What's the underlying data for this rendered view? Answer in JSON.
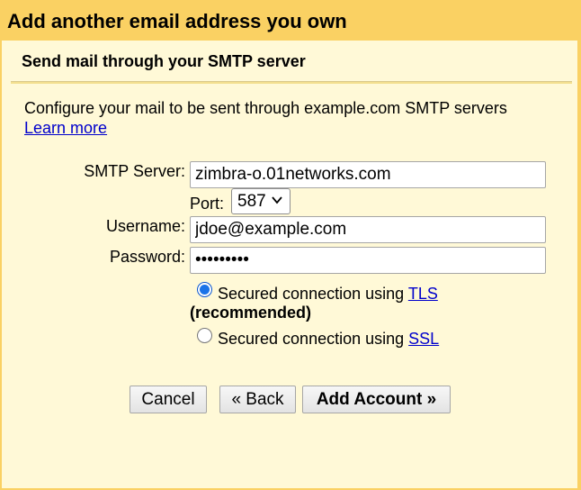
{
  "dialog": {
    "title": "Add another email address you own",
    "subtitle": "Send mail through your SMTP server",
    "description": "Configure your mail to be sent through example.com SMTP servers",
    "learn_more": "Learn more"
  },
  "form": {
    "smtp_label": "SMTP Server:",
    "smtp_value": "zimbra-o.01networks.com",
    "port_label": "Port:",
    "port_value": "587",
    "username_label": "Username:",
    "username_value": "jdoe@example.com",
    "password_label": "Password:",
    "password_mask": "•••••••••",
    "tls_text": "Secured connection using ",
    "tls_link": "TLS",
    "tls_recommended": "(recommended)",
    "ssl_text": "Secured connection using ",
    "ssl_link": "SSL",
    "selected_security": "TLS"
  },
  "buttons": {
    "cancel": "Cancel",
    "back": "« Back",
    "add_account": "Add Account »"
  },
  "colors": {
    "header_bg": "#fad163",
    "panel_bg": "#fff9d7",
    "link": "#0000cc",
    "radio_accent": "#1a73e8"
  }
}
